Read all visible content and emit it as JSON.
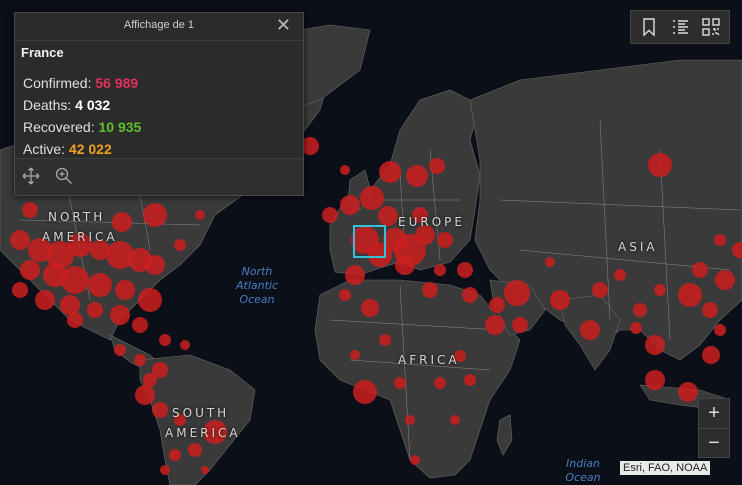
{
  "popup": {
    "header_title": "Affichage de 1",
    "close_glyph": "✕",
    "country": "France",
    "stats": [
      {
        "label": "Confirmed: ",
        "value": "56 989",
        "color": "#e0315b"
      },
      {
        "label": "Deaths: ",
        "value": "4 032",
        "color": "#ffffff"
      },
      {
        "label": "Recovered: ",
        "value": "10 935",
        "color": "#5fbf2a"
      },
      {
        "label": "Active: ",
        "value": "42 022",
        "color": "#f0a020"
      }
    ],
    "footer_icons": [
      "move-icon",
      "zoom-to-icon"
    ]
  },
  "toolbar": {
    "icons": [
      "bookmark-icon",
      "list-icon",
      "qr-code-icon"
    ]
  },
  "zoom": {
    "in_glyph": "+",
    "out_glyph": "−"
  },
  "map_labels": {
    "north_america": [
      "NORTH",
      "AMERICA"
    ],
    "south_america": [
      "SOUTH",
      "AMERICA"
    ],
    "europe": "EUROPE",
    "africa": "AFRICA",
    "asia": "ASIA",
    "north_atlantic": [
      "North",
      "Atlantic",
      "Ocean"
    ],
    "indian_ocean": [
      "Indian",
      "Ocean"
    ]
  },
  "attribution": "Esri, FAO, NOAA",
  "colors": {
    "bubble": "#cc1e1e",
    "land": "#3a3a3a",
    "water": "#0b1018",
    "selection": "#33c0d8"
  }
}
